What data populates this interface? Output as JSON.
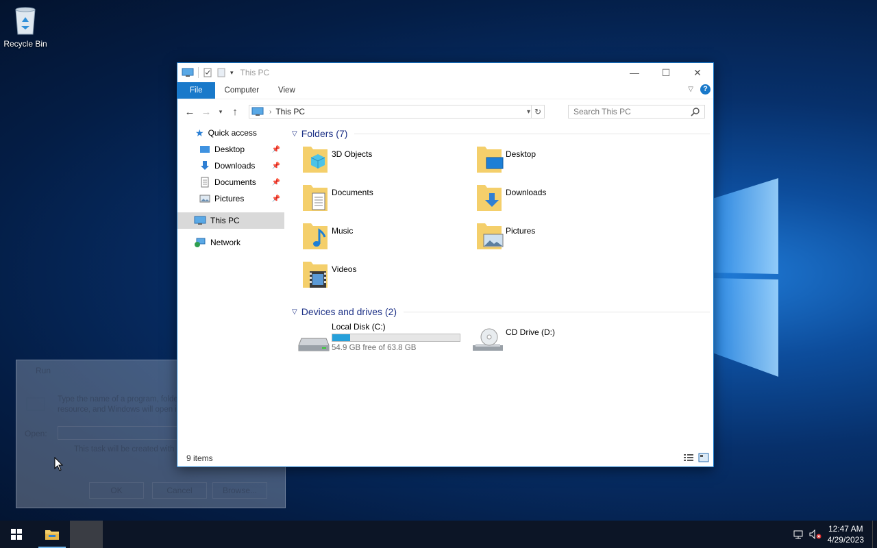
{
  "desktop": {
    "recycle_bin_label": "Recycle Bin"
  },
  "window": {
    "title": "This PC",
    "ribbon_tabs": [
      "File",
      "Computer",
      "View"
    ],
    "address": {
      "crumb": "This PC"
    },
    "search_placeholder": "Search This PC",
    "nav": {
      "quick_access": "Quick access",
      "pinned": [
        "Desktop",
        "Downloads",
        "Documents",
        "Pictures"
      ],
      "this_pc": "This PC",
      "network": "Network"
    },
    "folders_header": "Folders (7)",
    "folders": [
      "3D Objects",
      "Desktop",
      "Documents",
      "Downloads",
      "Music",
      "Pictures",
      "Videos"
    ],
    "drives_header": "Devices and drives (2)",
    "drives": [
      {
        "name": "Local Disk (C:)",
        "free_text": "54.9 GB free of 63.8 GB",
        "used_fraction": 0.14
      },
      {
        "name": "CD Drive (D:)"
      }
    ],
    "status_count": "9 items"
  },
  "run_dialog": {
    "title": "Run",
    "description": "Type the name of a program, folder, document, or Internet resource, and Windows will open it for you.",
    "open_label": "Open:",
    "admin_note": "This task will be created with administrative privileges.",
    "buttons": [
      "OK",
      "Cancel",
      "Browse..."
    ]
  },
  "taskbar": {
    "time": "12:47 AM",
    "date": "4/29/2023"
  },
  "colors": {
    "accent": "#1979ca",
    "drive_fill": "#26a0da"
  }
}
